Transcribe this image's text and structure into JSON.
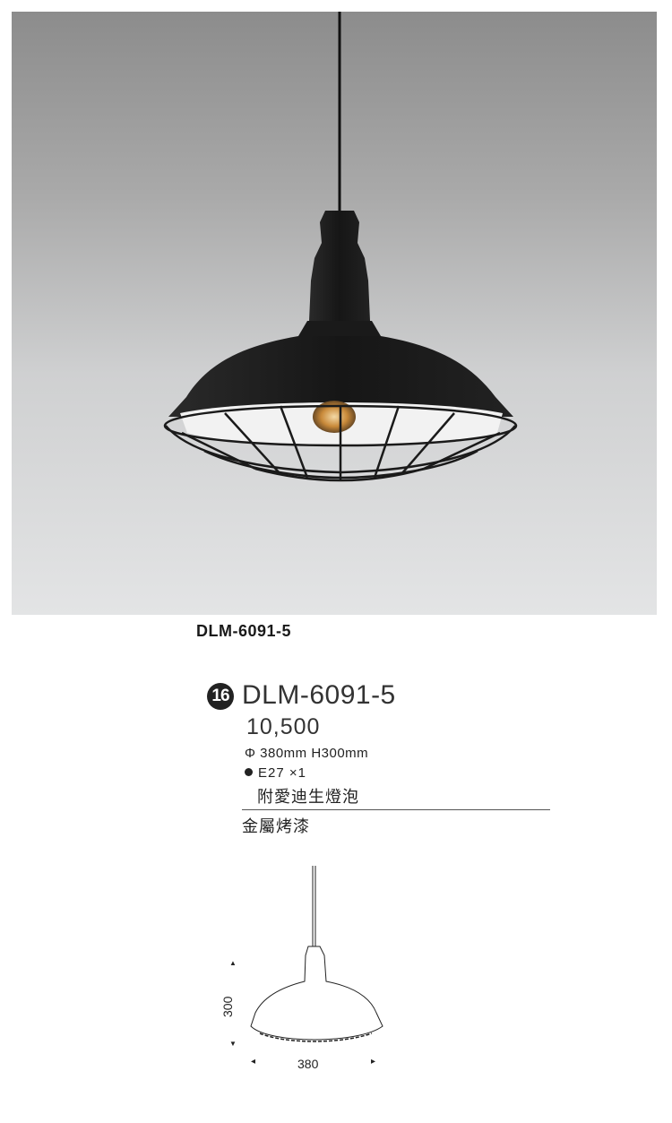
{
  "product": {
    "caption_model": "DLM-6091-5",
    "badge_number": "16",
    "model": "DLM-6091-5",
    "price": "10,500",
    "dimensions": "Φ 380mm H300mm",
    "bulb": "E27 ×1",
    "bulb_note": "附愛迪生燈泡",
    "material": "金屬烤漆"
  },
  "drawing": {
    "height_label": "300",
    "width_label": "380"
  },
  "colors": {
    "lamp": "#1c1c1c",
    "background_top": "#8c8c8c",
    "background_bottom": "#e3e4e5",
    "bulb_glow": "#c98a3a"
  },
  "icons": {
    "arrow_up": "▲",
    "arrow_down": "▼",
    "arrow_left": "◂",
    "arrow_right": "▸"
  }
}
